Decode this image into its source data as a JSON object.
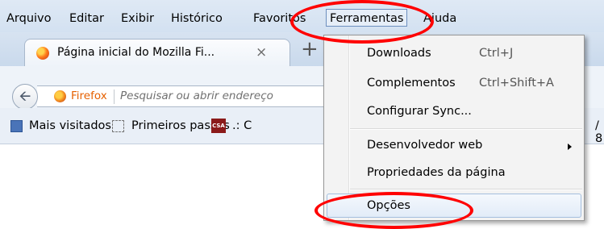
{
  "menubar": {
    "items": [
      "Arquivo",
      "Editar",
      "Exibir",
      "Histórico",
      "Favoritos",
      "Ferramentas",
      "Ajuda"
    ]
  },
  "tab": {
    "title": "Página inicial do Mozilla Fi...",
    "close": "×",
    "new_tab": "+"
  },
  "navbar": {
    "identity_label": "Firefox",
    "url_placeholder": "Pesquisar ou abrir endereço"
  },
  "bookmarks": {
    "items": [
      "Mais visitados",
      "Primeiros passos"
    ],
    "partial_item": ".: C",
    "trailing": "/ 8"
  },
  "tools_menu": {
    "items": [
      {
        "label": "Downloads",
        "shortcut": "Ctrl+J"
      },
      {
        "label": "Complementos",
        "shortcut": "Ctrl+Shift+A"
      },
      {
        "label": "Configurar Sync..."
      },
      {
        "label": "Desenvolvedor web"
      },
      {
        "label": "Propriedades da página"
      },
      {
        "label": "Opções"
      }
    ]
  },
  "annotations": {
    "highlight_color": "#ff0000"
  }
}
